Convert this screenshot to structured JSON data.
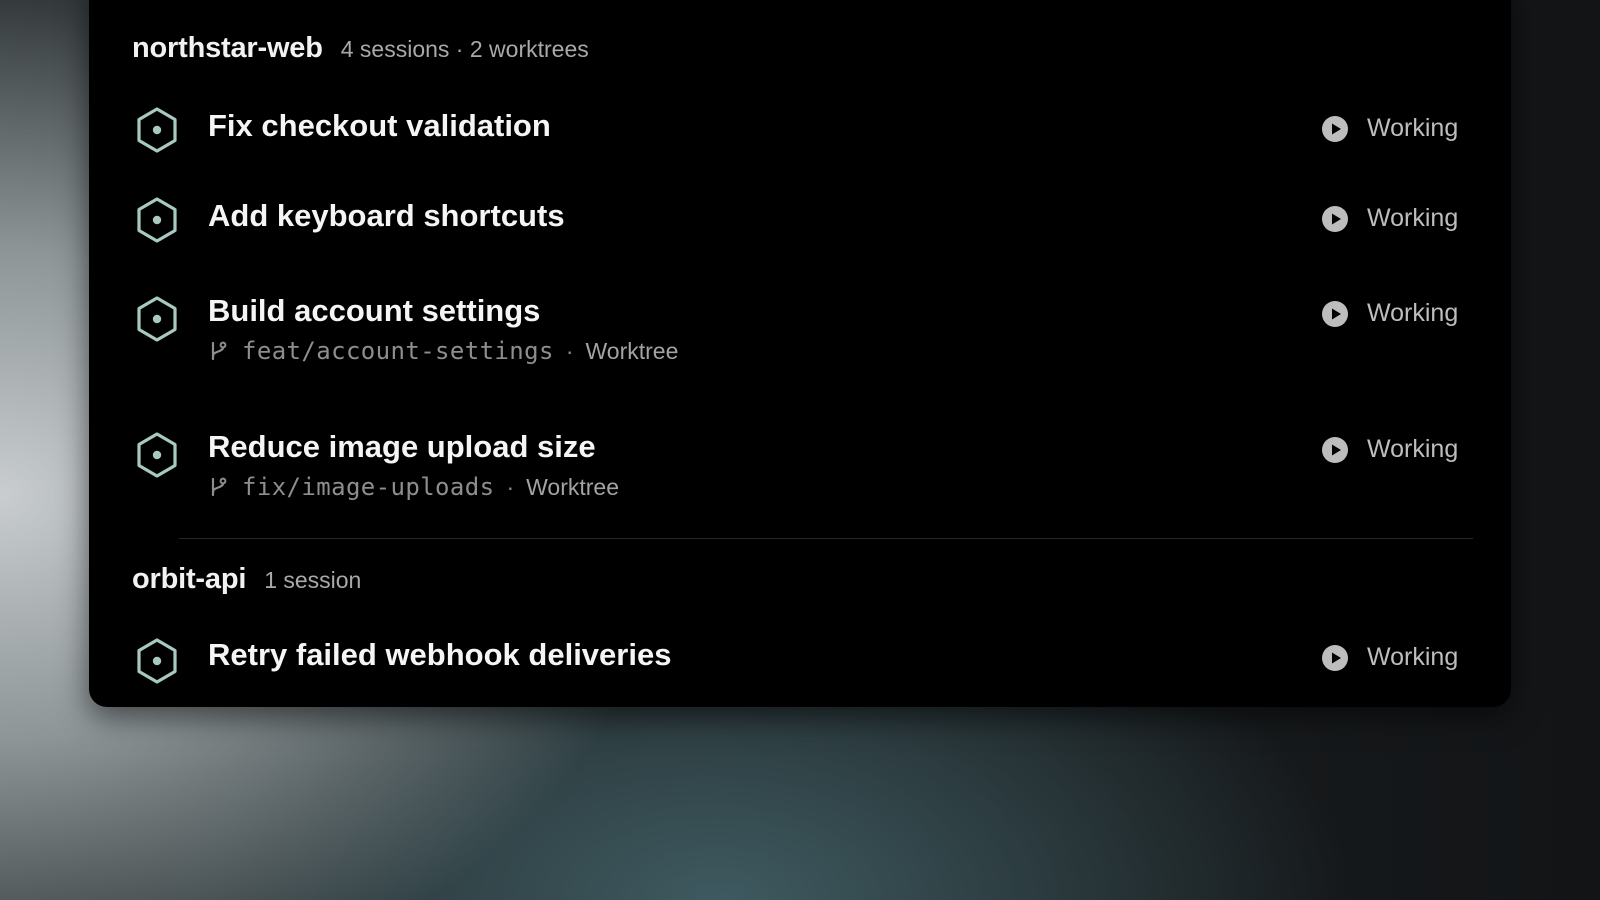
{
  "groups": [
    {
      "name": "northstar-web",
      "meta": "4 sessions · 2 worktrees",
      "sessions": [
        {
          "title": "Fix checkout validation",
          "status": "Working",
          "status_icon": "play-circle-icon",
          "icon": "hexagon-dot-icon"
        },
        {
          "title": "Add keyboard shortcuts",
          "status": "Working",
          "status_icon": "play-circle-icon",
          "icon": "hexagon-dot-icon"
        },
        {
          "title": "Build account settings",
          "status": "Working",
          "status_icon": "play-circle-icon",
          "icon": "hexagon-dot-icon",
          "branch": "feat/account-settings",
          "separator": "·",
          "kind": "Worktree",
          "branch_icon": "git-branch-icon"
        },
        {
          "title": "Reduce image upload size",
          "status": "Working",
          "status_icon": "play-circle-icon",
          "icon": "hexagon-dot-icon",
          "branch": "fix/image-uploads",
          "separator": "·",
          "kind": "Worktree",
          "branch_icon": "git-branch-icon"
        }
      ]
    },
    {
      "name": "orbit-api",
      "meta": "1 session",
      "sessions": [
        {
          "title": "Retry failed webhook deliveries",
          "status": "Working",
          "status_icon": "play-circle-icon",
          "icon": "hexagon-dot-icon"
        }
      ]
    }
  ],
  "colors": {
    "panel_bg": "#000000",
    "icon_accent": "#a7c9c1",
    "title_text": "#f5f5f5",
    "muted_text": "#a9a9a9",
    "status_icon": "#bdbdbd"
  }
}
